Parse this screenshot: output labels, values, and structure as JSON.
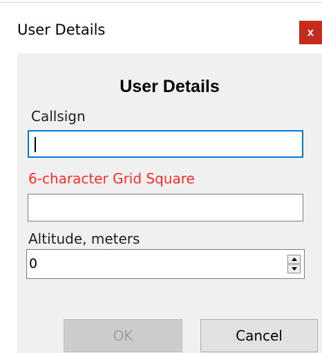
{
  "window": {
    "title": "User Details",
    "close_label": "x"
  },
  "form": {
    "heading": "User Details",
    "callsign": {
      "label": "Callsign",
      "value": ""
    },
    "grid_square": {
      "label": "6-character Grid Square",
      "value": ""
    },
    "altitude": {
      "label": "Altitude, meters",
      "value": "0"
    }
  },
  "buttons": {
    "ok_label": "OK",
    "ok_enabled": false,
    "cancel_label": "Cancel"
  },
  "colors": {
    "close_button": "#c42b1c",
    "grid_square_label": "#ff2b2b",
    "focus_border": "#0078d7",
    "client_background": "#f0f0f0"
  }
}
